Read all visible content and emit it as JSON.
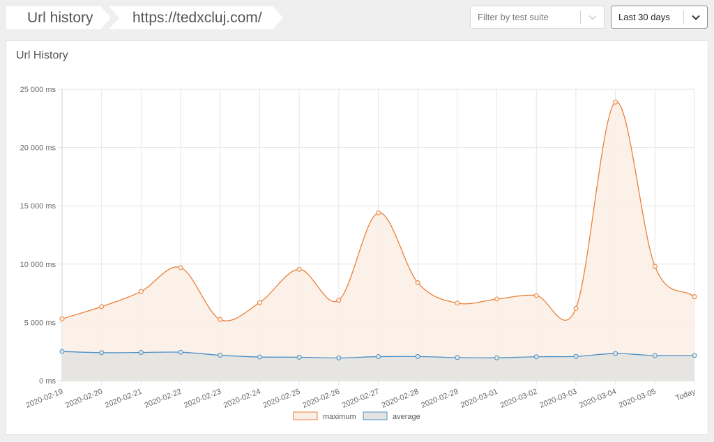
{
  "breadcrumbs": [
    {
      "label": "Url history"
    },
    {
      "label": "https://tedxcluj.com/"
    }
  ],
  "filters": {
    "test_suite_placeholder": "Filter by test suite",
    "range_value": "Last 30 days"
  },
  "panel": {
    "title": "Url History"
  },
  "chart_data": {
    "type": "line",
    "area_fill": true,
    "smooth": true,
    "categories": [
      "2020-02-19",
      "2020-02-20",
      "2020-02-21",
      "2020-02-22",
      "2020-02-23",
      "2020-02-24",
      "2020-02-25",
      "2020-02-26",
      "2020-02-27",
      "2020-02-28",
      "2020-02-29",
      "2020-03-01",
      "2020-03-02",
      "2020-03-03",
      "2020-03-04",
      "2020-03-05",
      "Today"
    ],
    "series": [
      {
        "name": "maximum",
        "color": "#e8803a",
        "fill": "#fbeee4",
        "values": [
          5300,
          6350,
          7650,
          9700,
          5250,
          6700,
          9550,
          6900,
          14400,
          8400,
          6650,
          7000,
          7300,
          6200,
          23900,
          9800,
          7200
        ]
      },
      {
        "name": "average",
        "color": "#4a90c8",
        "fill": "#e3e3df",
        "values": [
          2500,
          2400,
          2420,
          2440,
          2180,
          2030,
          2010,
          1950,
          2060,
          2070,
          1980,
          1960,
          2050,
          2080,
          2330,
          2150,
          2160
        ]
      }
    ],
    "ylim": [
      0,
      25000
    ],
    "y_ticks": [
      0,
      5000,
      10000,
      15000,
      20000,
      25000
    ],
    "y_tick_labels": [
      "0 ms",
      "5 000 ms",
      "10 000 ms",
      "15 000 ms",
      "20 000 ms",
      "25 000 ms"
    ],
    "grid": true,
    "legend": "bottom-center"
  }
}
